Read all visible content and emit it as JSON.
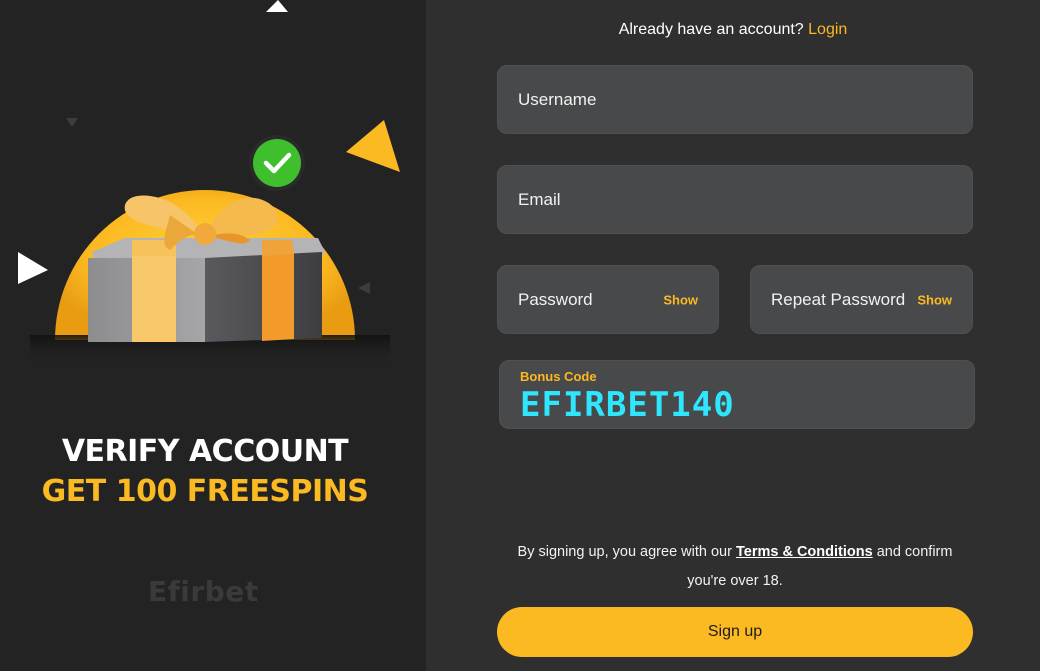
{
  "promo": {
    "title_line1": "VERIFY ACCOUNT",
    "title_line2": "GET 100 FREESPINS",
    "logo_text": "Efirbet"
  },
  "header": {
    "login_prompt": "Already have an account?",
    "login_link": "Login"
  },
  "form": {
    "username_placeholder": "Username",
    "email_placeholder": "Email",
    "password_placeholder": "Password",
    "password_show": "Show",
    "repeat_password_placeholder": "Repeat Password",
    "repeat_password_show": "Show",
    "bonus_label": "Bonus Code",
    "bonus_value": "EFIRBET140"
  },
  "terms": {
    "prefix": "By signing up, you agree with our",
    "link": "Terms & Conditions",
    "suffix": "and confirm you're over 18."
  },
  "signup": {
    "label": "Sign up"
  },
  "colors": {
    "accent": "#fbb922",
    "bonus_code": "#2ee7ff",
    "panel_dark": "#232324",
    "input_bg": "#48494a"
  }
}
